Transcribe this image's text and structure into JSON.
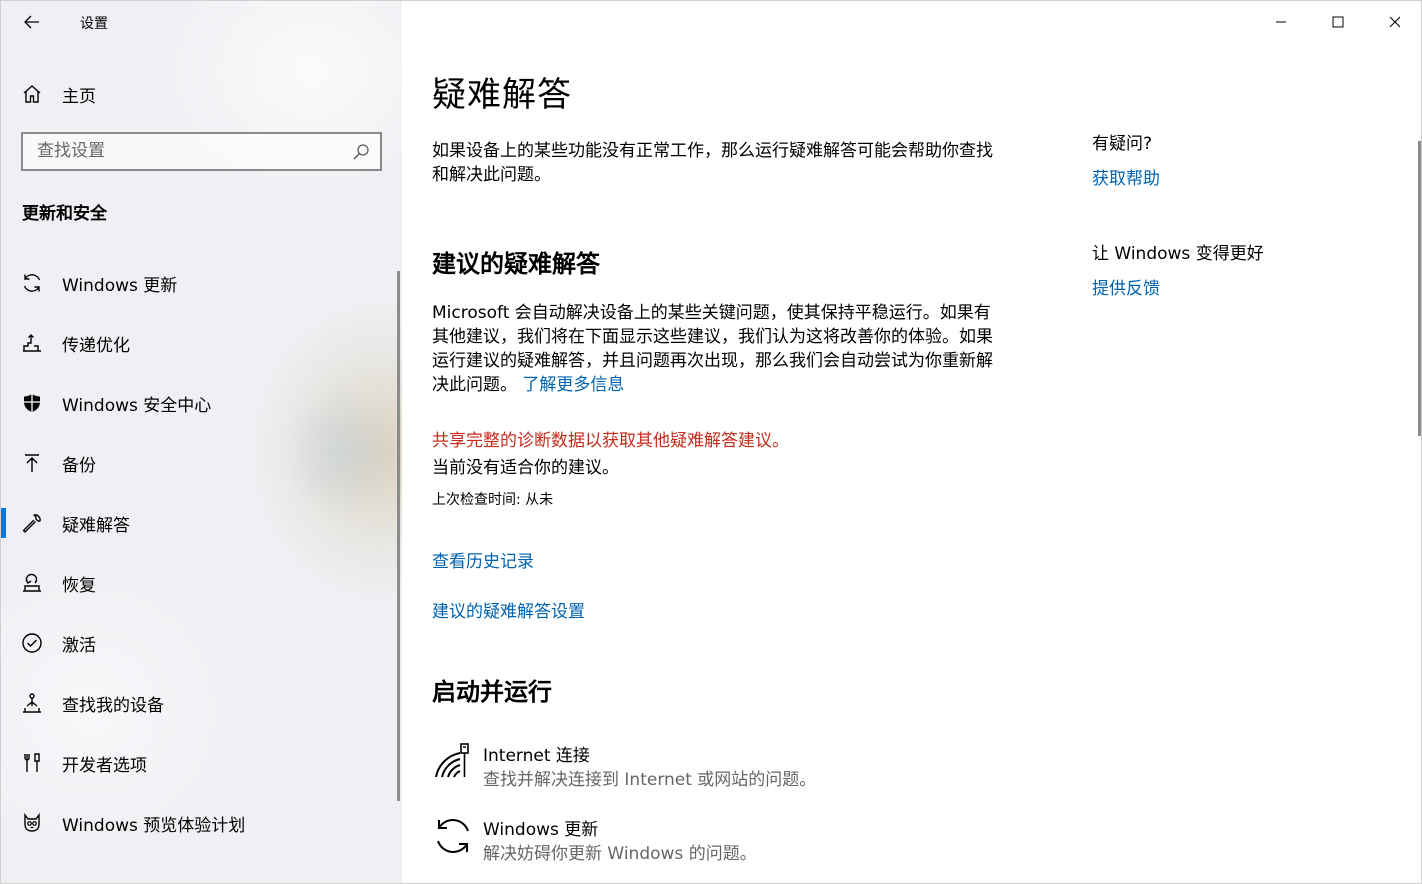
{
  "window": {
    "title": "设置"
  },
  "sidebar": {
    "home_label": "主页",
    "search_placeholder": "查找设置",
    "section_heading": "更新和安全",
    "items": [
      {
        "label": "Windows 更新",
        "icon": "sync-icon"
      },
      {
        "label": "传递优化",
        "icon": "delivery-optimization-icon"
      },
      {
        "label": "Windows 安全中心",
        "icon": "shield-icon"
      },
      {
        "label": "备份",
        "icon": "backup-arrow-icon"
      },
      {
        "label": "疑难解答",
        "icon": "wrench-icon",
        "active": true
      },
      {
        "label": "恢复",
        "icon": "recovery-icon"
      },
      {
        "label": "激活",
        "icon": "check-circle-icon"
      },
      {
        "label": "查找我的设备",
        "icon": "find-device-icon"
      },
      {
        "label": "开发者选项",
        "icon": "developer-tools-icon"
      },
      {
        "label": "Windows 预览体验计划",
        "icon": "insider-cat-icon"
      }
    ]
  },
  "main": {
    "title": "疑难解答",
    "intro": "如果设备上的某些功能没有正常工作，那么运行疑难解答可能会帮助你查找和解决此问题。",
    "recommended_heading": "建议的疑难解答",
    "recommended_text": "Microsoft 会自动解决设备上的某些关键问题，使其保持平稳运行。如果有其他建议，我们将在下面显示这些建议，我们认为这将改善你的体验。如果运行建议的疑难解答，并且问题再次出现，那么我们会自动尝试为你重新解决此问题。",
    "learn_more": "了解更多信息",
    "warning": "共享完整的诊断数据以获取其他疑难解答建议。",
    "no_suggestions": "当前没有适合你的建议。",
    "last_checked": "上次检查时间: 从未",
    "view_history": "查看历史记录",
    "recommended_settings": "建议的疑难解答设置",
    "get_up_heading": "启动并运行",
    "troubleshooters": [
      {
        "title": "Internet 连接",
        "desc": "查找并解决连接到 Internet 或网站的问题。",
        "icon": "internet-connection-icon"
      },
      {
        "title": "Windows 更新",
        "desc": "解决妨碍你更新 Windows 的问题。",
        "icon": "windows-update-icon"
      }
    ]
  },
  "side_panel": {
    "question": "有疑问?",
    "get_help": "获取帮助",
    "improve": "让 Windows 变得更好",
    "feedback": "提供反馈"
  },
  "colors": {
    "accent": "#0078d7",
    "link": "#0063b1",
    "warning": "#c42b1c"
  }
}
